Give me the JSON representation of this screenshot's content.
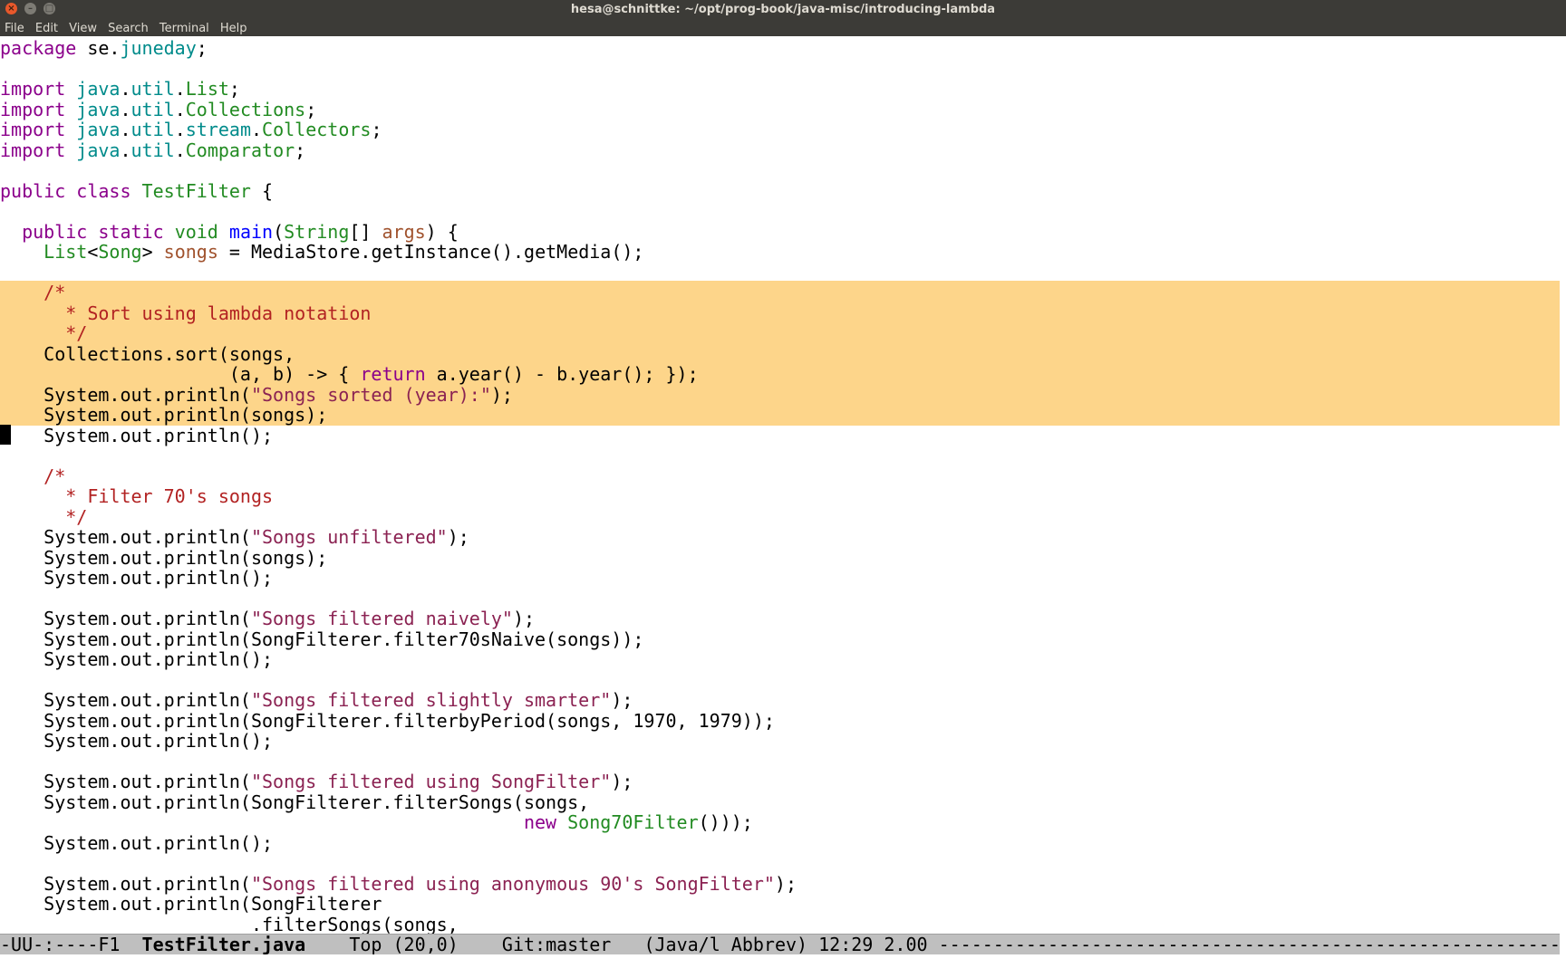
{
  "window": {
    "title": "hesa@schnittke: ~/opt/prog-book/java-misc/introducing-lambda",
    "close_glyph": "×",
    "min_glyph": "–",
    "max_glyph": "□"
  },
  "menubar": {
    "items": [
      "File",
      "Edit",
      "View",
      "Search",
      "Terminal",
      "Help"
    ]
  },
  "colors": {
    "keyword": "#8b008b",
    "package": "#008b8b",
    "type": "#228b22",
    "function": "#0000ff",
    "variable": "#a0522d",
    "comment": "#b22222",
    "string": "#8b2252",
    "region_highlight": "#fdd58a"
  },
  "editor": {
    "highlighted_lines": [
      12,
      13,
      14,
      15,
      16,
      17,
      18
    ],
    "cursor_line": 19,
    "lines": [
      [
        [
          "kw",
          "package"
        ],
        [
          "c0",
          " se."
        ],
        [
          "pk",
          "juneday"
        ],
        [
          "c0",
          ";"
        ]
      ],
      [],
      [
        [
          "kw",
          "import"
        ],
        [
          "c0",
          " "
        ],
        [
          "pk",
          "java"
        ],
        [
          "c0",
          "."
        ],
        [
          "pk",
          "util"
        ],
        [
          "c0",
          "."
        ],
        [
          "ty",
          "List"
        ],
        [
          "c0",
          ";"
        ]
      ],
      [
        [
          "kw",
          "import"
        ],
        [
          "c0",
          " "
        ],
        [
          "pk",
          "java"
        ],
        [
          "c0",
          "."
        ],
        [
          "pk",
          "util"
        ],
        [
          "c0",
          "."
        ],
        [
          "ty",
          "Collections"
        ],
        [
          "c0",
          ";"
        ]
      ],
      [
        [
          "kw",
          "import"
        ],
        [
          "c0",
          " "
        ],
        [
          "pk",
          "java"
        ],
        [
          "c0",
          "."
        ],
        [
          "pk",
          "util"
        ],
        [
          "c0",
          "."
        ],
        [
          "pk",
          "stream"
        ],
        [
          "c0",
          "."
        ],
        [
          "ty",
          "Collectors"
        ],
        [
          "c0",
          ";"
        ]
      ],
      [
        [
          "kw",
          "import"
        ],
        [
          "c0",
          " "
        ],
        [
          "pk",
          "java"
        ],
        [
          "c0",
          "."
        ],
        [
          "pk",
          "util"
        ],
        [
          "c0",
          "."
        ],
        [
          "ty",
          "Comparator"
        ],
        [
          "c0",
          ";"
        ]
      ],
      [],
      [
        [
          "kw",
          "public class"
        ],
        [
          "c0",
          " "
        ],
        [
          "ty",
          "TestFilter"
        ],
        [
          "c0",
          " {"
        ]
      ],
      [],
      [
        [
          "c0",
          "  "
        ],
        [
          "kw",
          "public static"
        ],
        [
          "c0",
          " "
        ],
        [
          "ty",
          "void"
        ],
        [
          "c0",
          " "
        ],
        [
          "fn",
          "main"
        ],
        [
          "c0",
          "("
        ],
        [
          "ty",
          "String"
        ],
        [
          "c0",
          "[] "
        ],
        [
          "va",
          "args"
        ],
        [
          "c0",
          ") {"
        ]
      ],
      [
        [
          "c0",
          "    "
        ],
        [
          "ty",
          "List"
        ],
        [
          "c0",
          "<"
        ],
        [
          "ty",
          "Song"
        ],
        [
          "c0",
          "> "
        ],
        [
          "va",
          "songs"
        ],
        [
          "c0",
          " = MediaStore.getInstance().getMedia();"
        ]
      ],
      [],
      [
        [
          "c0",
          "    "
        ],
        [
          "cm",
          "/*"
        ]
      ],
      [
        [
          "c0",
          "    "
        ],
        [
          "cm",
          "  * Sort using lambda notation"
        ]
      ],
      [
        [
          "c0",
          "    "
        ],
        [
          "cm",
          "  */"
        ]
      ],
      [
        [
          "c0",
          "    Collections.sort(songs,"
        ]
      ],
      [
        [
          "c0",
          "                     (a, b) -> { "
        ],
        [
          "kw",
          "return"
        ],
        [
          "c0",
          " a.year() - b.year(); });"
        ]
      ],
      [
        [
          "c0",
          "    System.out.println("
        ],
        [
          "st",
          "\"Songs sorted (year):\""
        ],
        [
          "c0",
          ");"
        ]
      ],
      [
        [
          "c0",
          "    System.out.println(songs);"
        ]
      ],
      [
        [
          "c0",
          "    System.out.println();"
        ]
      ],
      [],
      [
        [
          "c0",
          "    "
        ],
        [
          "cm",
          "/*"
        ]
      ],
      [
        [
          "c0",
          "    "
        ],
        [
          "cm",
          "  * Filter 70's songs"
        ]
      ],
      [
        [
          "c0",
          "    "
        ],
        [
          "cm",
          "  */"
        ]
      ],
      [
        [
          "c0",
          "    System.out.println("
        ],
        [
          "st",
          "\"Songs unfiltered\""
        ],
        [
          "c0",
          ");"
        ]
      ],
      [
        [
          "c0",
          "    System.out.println(songs);"
        ]
      ],
      [
        [
          "c0",
          "    System.out.println();"
        ]
      ],
      [],
      [
        [
          "c0",
          "    System.out.println("
        ],
        [
          "st",
          "\"Songs filtered naively\""
        ],
        [
          "c0",
          ");"
        ]
      ],
      [
        [
          "c0",
          "    System.out.println(SongFilterer.filter70sNaive(songs));"
        ]
      ],
      [
        [
          "c0",
          "    System.out.println();"
        ]
      ],
      [],
      [
        [
          "c0",
          "    System.out.println("
        ],
        [
          "st",
          "\"Songs filtered slightly smarter\""
        ],
        [
          "c0",
          ");"
        ]
      ],
      [
        [
          "c0",
          "    System.out.println(SongFilterer.filterbyPeriod(songs, 1970, 1979));"
        ]
      ],
      [
        [
          "c0",
          "    System.out.println();"
        ]
      ],
      [],
      [
        [
          "c0",
          "    System.out.println("
        ],
        [
          "st",
          "\"Songs filtered using SongFilter\""
        ],
        [
          "c0",
          ");"
        ]
      ],
      [
        [
          "c0",
          "    System.out.println(SongFilterer.filterSongs(songs,"
        ]
      ],
      [
        [
          "c0",
          "                                                "
        ],
        [
          "kw",
          "new"
        ],
        [
          "c0",
          " "
        ],
        [
          "ty",
          "Song70Filter"
        ],
        [
          "c0",
          "()));"
        ]
      ],
      [
        [
          "c0",
          "    System.out.println();"
        ]
      ],
      [],
      [
        [
          "c0",
          "    System.out.println("
        ],
        [
          "st",
          "\"Songs filtered using anonymous 90's SongFilter\""
        ],
        [
          "c0",
          ");"
        ]
      ],
      [
        [
          "c0",
          "    System.out.println(SongFilterer"
        ]
      ],
      [
        [
          "c0",
          "                       .filterSongs(songs,"
        ]
      ]
    ]
  },
  "modeline": {
    "status": "-UU-:----F1  ",
    "buffer_name": "TestFilter.java",
    "position": "    Top (20,0)    ",
    "vcs": "Git:master",
    "mode": "   (Java/l Abbrev) 12:29 2.00 ",
    "fill": "-----------------------------------------------------------------------------------------"
  }
}
